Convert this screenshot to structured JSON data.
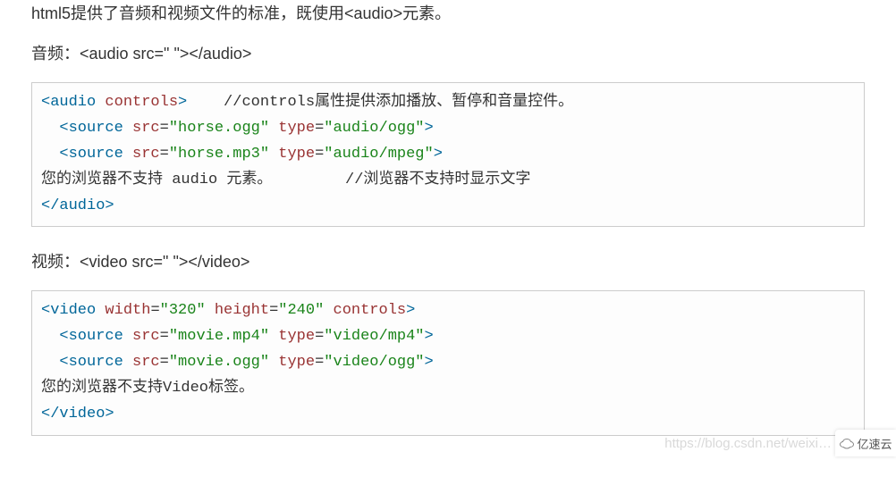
{
  "intro": "html5提供了音频和视频文件的标准，既使用<audio>元素。",
  "audio_label": "音频：<audio src=\" \"></audio>",
  "video_label": "视频：<video src=\" \"></video>",
  "code_audio": {
    "l1_open": "<",
    "l1_tag": "audio",
    "l1_sp": " ",
    "l1_attr": "controls",
    "l1_close": ">",
    "l1_cmt": "    //controls属性提供添加播放、暂停和音量控件。",
    "l2_indent": "  ",
    "l2_open": "<",
    "l2_tag": "source",
    "l2_a1": " src",
    "l2_eq1": "=",
    "l2_v1": "\"horse.ogg\"",
    "l2_a2": " type",
    "l2_eq2": "=",
    "l2_v2": "\"audio/ogg\"",
    "l2_close": ">",
    "l3_indent": "  ",
    "l3_open": "<",
    "l3_tag": "source",
    "l3_a1": " src",
    "l3_eq1": "=",
    "l3_v1": "\"horse.mp3\"",
    "l3_a2": " type",
    "l3_eq2": "=",
    "l3_v2": "\"audio/mpeg\"",
    "l3_close": ">",
    "l4_txt": "您的浏览器不支持 audio 元素。        //浏览器不支持时显示文字",
    "l5_open": "</",
    "l5_tag": "audio",
    "l5_close": ">"
  },
  "code_video": {
    "l1_open": "<",
    "l1_tag": "video",
    "l1_a1": " width",
    "l1_eq1": "=",
    "l1_v1": "\"320\"",
    "l1_a2": " height",
    "l1_eq2": "=",
    "l1_v2": "\"240\"",
    "l1_a3": " controls",
    "l1_close": ">",
    "l2_indent": "  ",
    "l2_open": "<",
    "l2_tag": "source",
    "l2_a1": " src",
    "l2_eq1": "=",
    "l2_v1": "\"movie.mp4\"",
    "l2_a2": " type",
    "l2_eq2": "=",
    "l2_v2": "\"video/mp4\"",
    "l2_close": ">",
    "l3_indent": "  ",
    "l3_open": "<",
    "l3_tag": "source",
    "l3_a1": " src",
    "l3_eq1": "=",
    "l3_v1": "\"movie.ogg\"",
    "l3_a2": " type",
    "l3_eq2": "=",
    "l3_v2": "\"video/ogg\"",
    "l3_close": ">",
    "l4_txt": "您的浏览器不支持Video标签。",
    "l5_open": "</",
    "l5_tag": "video",
    "l5_close": ">"
  },
  "watermark": "https://blog.csdn.net/weixi…",
  "logo_text": "亿速云"
}
